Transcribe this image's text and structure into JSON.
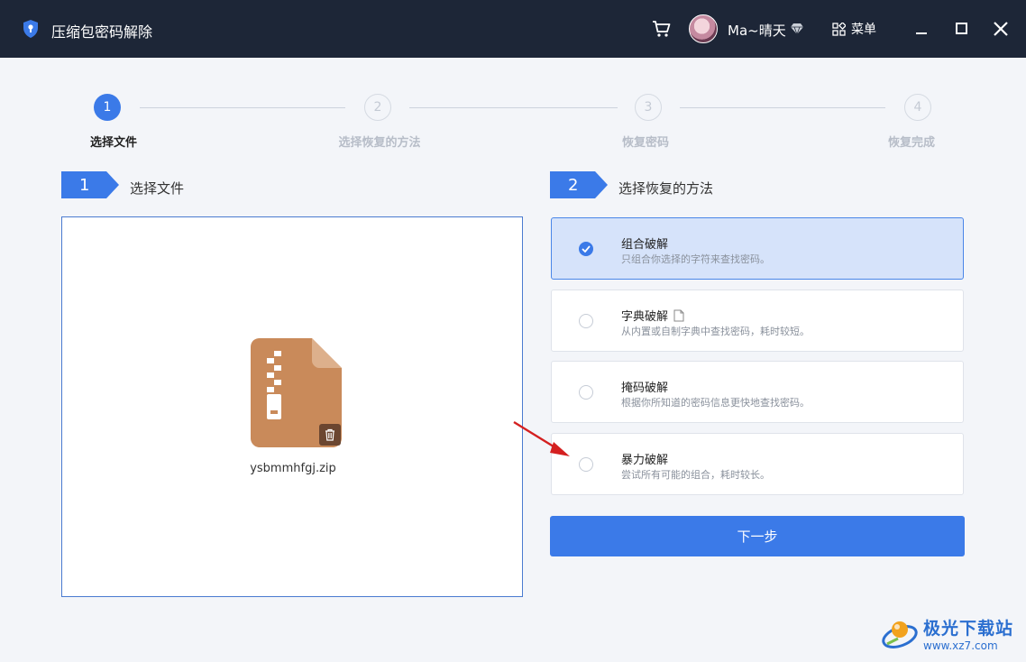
{
  "app": {
    "title": "压缩包密码解除"
  },
  "header": {
    "username": "Ma~晴天",
    "menu_label": "菜单"
  },
  "steps": [
    {
      "num": "1",
      "label": "选择文件"
    },
    {
      "num": "2",
      "label": "选择恢复的方法"
    },
    {
      "num": "3",
      "label": "恢复密码"
    },
    {
      "num": "4",
      "label": "恢复完成"
    }
  ],
  "sections": {
    "file": {
      "num": "1",
      "title": "选择文件"
    },
    "method": {
      "num": "2",
      "title": "选择恢复的方法"
    }
  },
  "file": {
    "name": "ysbmmhfgj.zip"
  },
  "methods": [
    {
      "title": "组合破解",
      "desc": "只组合你选择的字符来查找密码。",
      "selected": true
    },
    {
      "title": "字典破解",
      "desc": "从内置或自制字典中查找密码，耗时较短。",
      "selected": false
    },
    {
      "title": "掩码破解",
      "desc": "根据你所知道的密码信息更快地查找密码。",
      "selected": false
    },
    {
      "title": "暴力破解",
      "desc": "尝试所有可能的组合，耗时较长。",
      "selected": false
    }
  ],
  "next_label": "下一步",
  "watermark": {
    "title": "极光下载站",
    "url": "www.xz7.com"
  },
  "colors": {
    "accent": "#3b7ae8",
    "titlebar": "#1d2637",
    "zip": "#c98a5a"
  }
}
